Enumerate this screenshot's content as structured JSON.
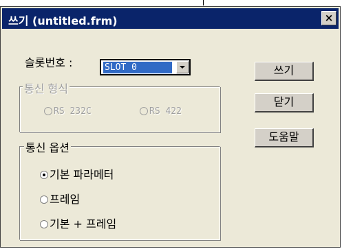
{
  "window": {
    "title": "쓰기 (untitled.frm)",
    "close_glyph": "×"
  },
  "slot": {
    "label": "슬롯번호 :",
    "value": "SLOT 0"
  },
  "comm_type": {
    "title": "통신 형식",
    "options": [
      "RS 232C",
      "RS 422"
    ]
  },
  "comm_options": {
    "title": "통신 옵션",
    "options": [
      "기본 파라메터",
      "프레임",
      "기본 + 프레임"
    ],
    "selected": 0
  },
  "buttons": {
    "write": "쓰기",
    "close": "닫기",
    "help": "도움말"
  }
}
